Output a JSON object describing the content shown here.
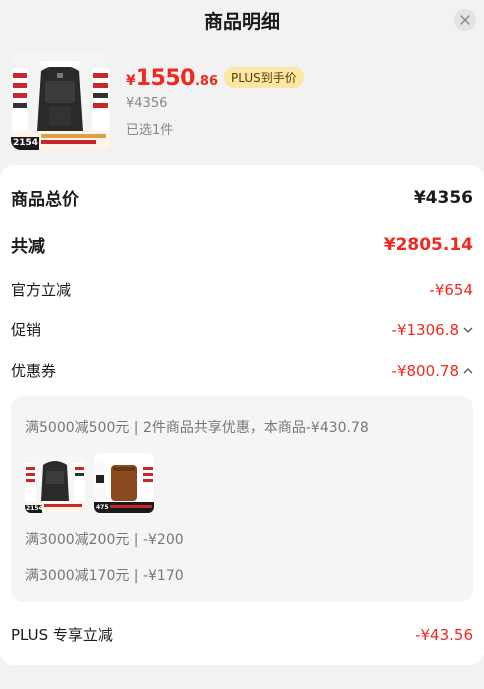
{
  "header": {
    "title": "商品明细"
  },
  "product": {
    "price_currency": "¥",
    "price_int": "1550",
    "price_dec": ".86",
    "plus_label": "PLUS到手价",
    "original_price": "¥4356",
    "selected_text": "已选1件",
    "thumb_badge": "2154"
  },
  "summary": {
    "total_label": "商品总价",
    "total_value": "¥4356",
    "discount_label": "共减",
    "discount_value": "¥2805.14",
    "official_label": "官方立减",
    "official_value": "-¥654",
    "promo_label": "促销",
    "promo_value": "-¥1306.8",
    "coupon_label": "优惠券",
    "coupon_value": "-¥800.78"
  },
  "coupons": {
    "line1": "满5000减500元 | 2件商品共享优惠，本商品-¥430.78",
    "line2": "满3000减200元 | -¥200",
    "line3": "满3000减170元 | -¥170",
    "thumb1_badge": "2154",
    "thumb2_badge": "475"
  },
  "plus": {
    "label": "PLUS 专享立减",
    "value": "-¥43.56"
  },
  "colors": {
    "accent": "#f0291e",
    "plus_bg": "#fbe7a3"
  },
  "icons": [
    "close-icon",
    "chevron-down-icon",
    "chevron-up-icon"
  ]
}
